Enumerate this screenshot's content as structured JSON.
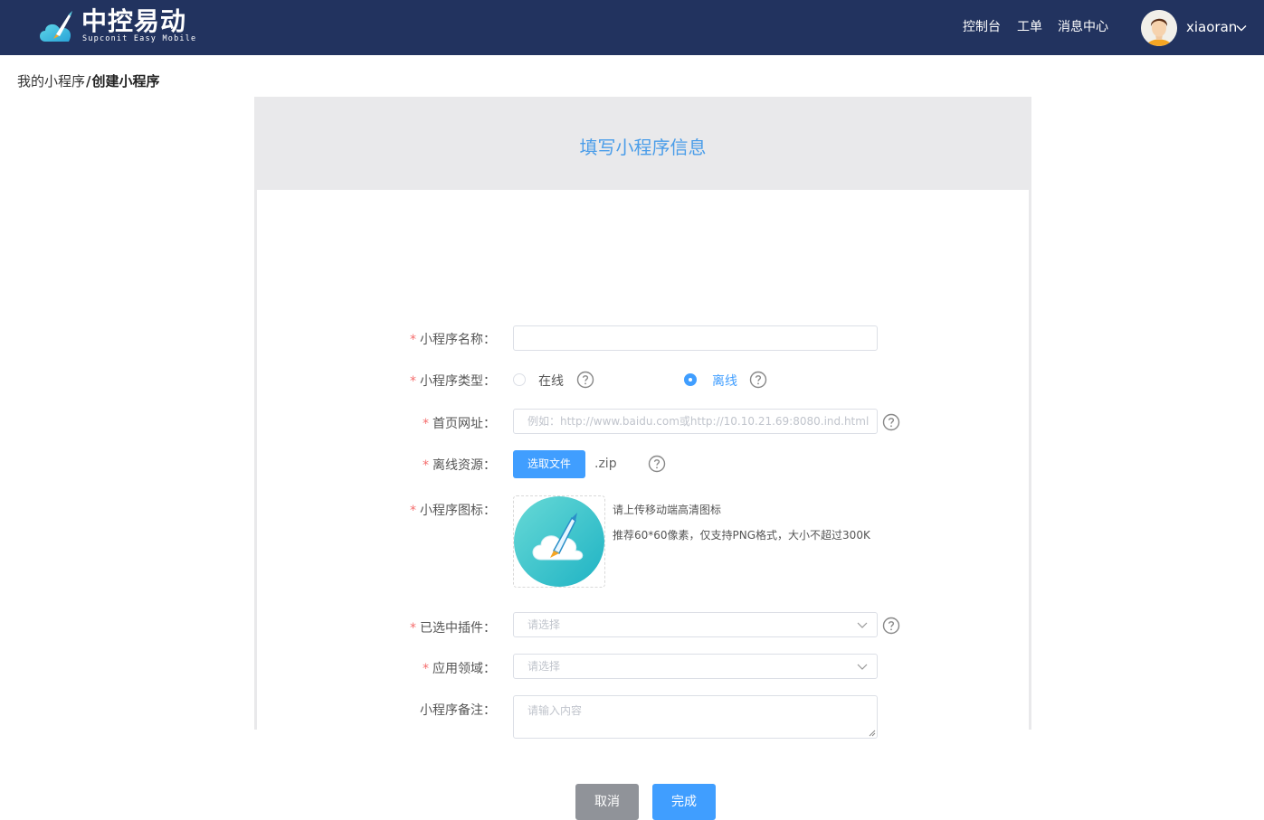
{
  "header": {
    "brand": "中控易动",
    "brand_sub": "Supconit Easy Mobile",
    "nav": [
      "控制台",
      "工单",
      "消息中心"
    ],
    "username": "xiaoran"
  },
  "breadcrumb": {
    "parent": "我的小程序",
    "separator": "/",
    "current": "创建小程序"
  },
  "card": {
    "title": "填写小程序信息"
  },
  "form": {
    "required_mark": "*",
    "name": {
      "label": "小程序名称："
    },
    "type": {
      "label": "小程序类型：",
      "options": [
        "在线",
        "离线"
      ],
      "selected": "离线"
    },
    "homepage": {
      "label": "首页网址：",
      "placeholder": "例如：http://www.baidu.com或http://10.10.21.69:8080.ind.html"
    },
    "offline": {
      "label": "离线资源：",
      "button": "选取文件",
      "ext": ".zip"
    },
    "icon": {
      "label": "小程序图标：",
      "hint1": "请上传移动端高清图标",
      "hint2": "推荐60*60像素，仅支持PNG格式，大小不超过300K"
    },
    "plugins": {
      "label": "已选中插件：",
      "placeholder": "请选择"
    },
    "domain": {
      "label": "应用领域：",
      "placeholder": "请选择"
    },
    "remark": {
      "label": "小程序备注：",
      "placeholder": "请输入内容"
    }
  },
  "actions": {
    "cancel": "取消",
    "ok": "完成"
  },
  "colors": {
    "header_bg": "#22335f",
    "primary": "#409eff",
    "required": "#f56c6c",
    "title": "#4a9de9"
  }
}
